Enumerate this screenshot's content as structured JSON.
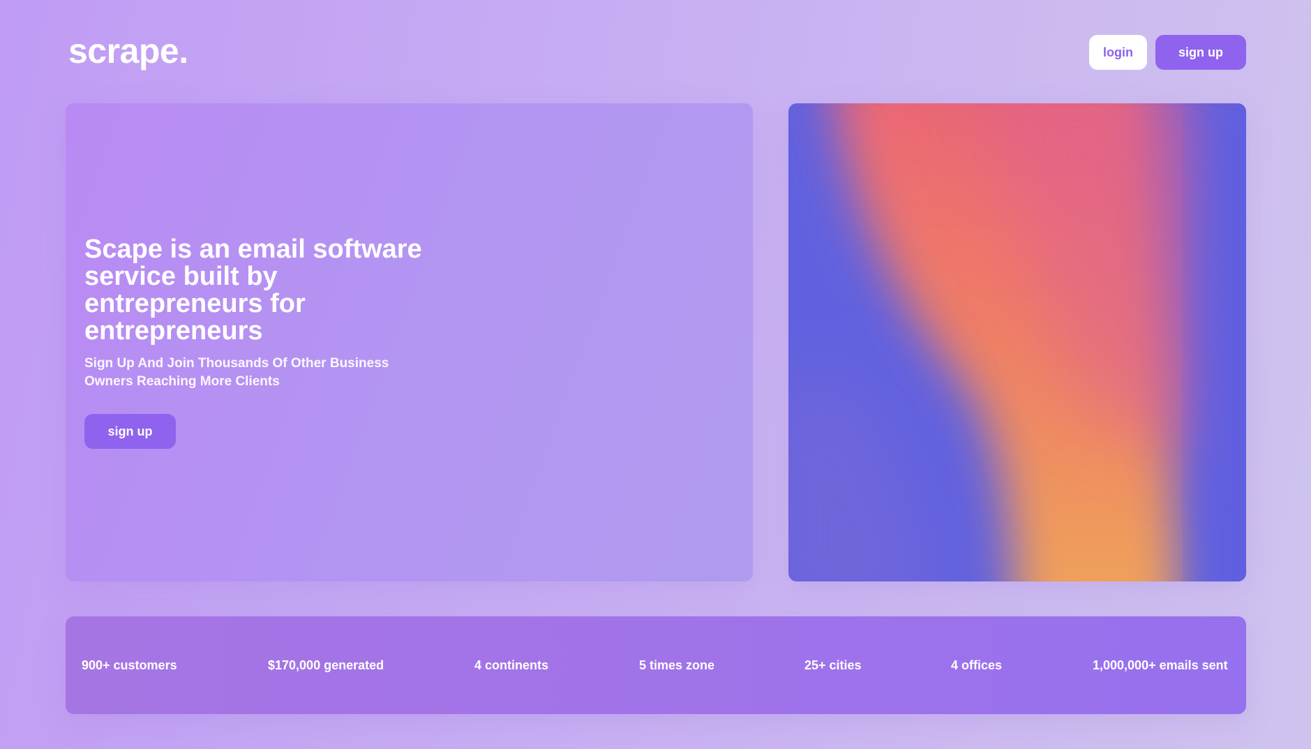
{
  "header": {
    "logo": "scrape.",
    "login_label": "login",
    "signup_label": "sign up"
  },
  "hero": {
    "title": "Scape is an email software service built by entrepreneurs for entrepreneurs",
    "subtitle": "Sign Up And Join Thousands Of Other Business Owners Reaching More Clients",
    "cta_label": "sign up"
  },
  "stats": [
    "900+ customers",
    "$170,000 generated",
    "4 continents",
    "5 times zone",
    "25+ cities",
    "4 offices",
    "1,000,000+ emails sent"
  ],
  "colors": {
    "accent": "#8f63ee",
    "background": "#c7aef3",
    "hero_card": "#b395f2",
    "stats_bar": "#a173e8",
    "art_blue": "#5f5fe0",
    "art_pink": "#ea6480",
    "art_orange": "#f0a45a"
  }
}
